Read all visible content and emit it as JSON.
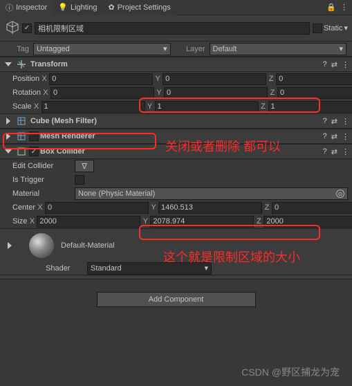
{
  "tabs": {
    "inspector": "Inspector",
    "lighting": "Lighting",
    "settings": "Project Settings"
  },
  "go": {
    "name": "相机限制区域",
    "static_label": "Static",
    "tag_label": "Tag",
    "tag_value": "Untagged",
    "layer_label": "Layer",
    "layer_value": "Default"
  },
  "transform": {
    "title": "Transform",
    "position": "Position",
    "rotation": "Rotation",
    "scale": "Scale",
    "pos": {
      "x": "0",
      "y": "0",
      "z": "0"
    },
    "rot": {
      "x": "0",
      "y": "0",
      "z": "0"
    },
    "scl": {
      "x": "1",
      "y": "1",
      "z": "1"
    }
  },
  "meshfilter": {
    "title": "Cube (Mesh Filter)"
  },
  "meshrenderer": {
    "title": "Mesh Renderer"
  },
  "boxcollider": {
    "title": "Box Collider",
    "edit": "Edit Collider",
    "trigger": "Is Trigger",
    "material": "Material",
    "material_value": "None (Physic Material)",
    "center": "Center",
    "size": "Size",
    "center_v": {
      "x": "0",
      "y": "1460.513",
      "z": "0"
    },
    "size_v": {
      "x": "2000",
      "y": "2078.974",
      "z": "2000"
    }
  },
  "material": {
    "name": "Default-Material",
    "shader_label": "Shader",
    "shader_value": "Standard"
  },
  "add": "Add Component",
  "annot1": "关闭或者删除 都可以",
  "annot2": "这个就是限制区域的大小",
  "watermark": "CSDN @野区捕龙为宠",
  "X": "X",
  "Y": "Y",
  "Z": "Z",
  "arrow": "▾",
  "check": "✓",
  "dots": "⋮",
  "help": "?",
  "reset": "⇄"
}
